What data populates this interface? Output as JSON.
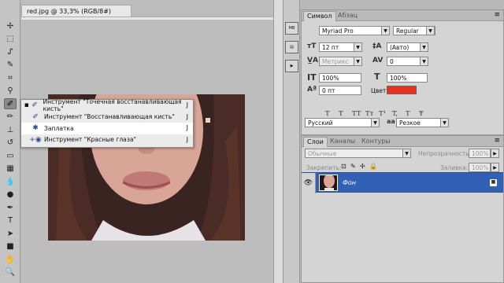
{
  "document": {
    "tab_title": "red.jpg @ 33,3% (RGB/8#)"
  },
  "toolbar": {
    "tools": [
      {
        "name": "move-tool",
        "glyph": "✢"
      },
      {
        "name": "marquee-tool",
        "glyph": "⬚"
      },
      {
        "name": "lasso-tool",
        "glyph": "ᔑ"
      },
      {
        "name": "quick-selection-tool",
        "glyph": "✎"
      },
      {
        "name": "crop-tool",
        "glyph": "⌗"
      },
      {
        "name": "eyedropper-tool",
        "glyph": "⚲"
      },
      {
        "name": "healing-brush-tool",
        "glyph": "✐"
      },
      {
        "name": "brush-tool",
        "glyph": "✏"
      },
      {
        "name": "clone-stamp-tool",
        "glyph": "⊥"
      },
      {
        "name": "history-brush-tool",
        "glyph": "↺"
      },
      {
        "name": "eraser-tool",
        "glyph": "▭"
      },
      {
        "name": "gradient-tool",
        "glyph": "▦"
      },
      {
        "name": "blur-tool",
        "glyph": "💧"
      },
      {
        "name": "dodge-tool",
        "glyph": "●"
      },
      {
        "name": "pen-tool",
        "glyph": "✒"
      },
      {
        "name": "type-tool",
        "glyph": "T"
      },
      {
        "name": "path-selection-tool",
        "glyph": "➤"
      },
      {
        "name": "shape-tool",
        "glyph": "■"
      },
      {
        "name": "hand-tool",
        "glyph": "✋"
      },
      {
        "name": "zoom-tool",
        "glyph": "🔍"
      }
    ]
  },
  "flyout": {
    "items": [
      {
        "mark": "▪",
        "icon": "spot-healing-icon",
        "glyph": "✐",
        "label": "Инструмент \"Точечная восстанавливающая кисть\"",
        "key": "J",
        "selected": false
      },
      {
        "mark": "",
        "icon": "healing-brush-icon",
        "glyph": "✐",
        "label": "Инструмент \"Восстанавливающая кисть\"",
        "key": "J",
        "selected": false
      },
      {
        "mark": "",
        "icon": "patch-icon",
        "glyph": "✱",
        "label": "Заплатка",
        "key": "J",
        "selected": true
      },
      {
        "mark": "",
        "icon": "red-eye-icon",
        "glyph": "+◉",
        "label": "Инструмент \"Красные глаза\"",
        "key": "J",
        "selected": false
      }
    ]
  },
  "character_panel": {
    "tab_active": "Символ",
    "tab_inactive": "Абзац",
    "font_family": "Myriad Pro",
    "font_style": "Regular",
    "font_size": "12 пт",
    "leading": "(Авто)",
    "kerning": "Метрикс",
    "tracking": "0",
    "vertical_scale": "100%",
    "horizontal_scale": "100%",
    "baseline_shift": "0 пт",
    "color_label": "Цвет:",
    "color_value": "#e8321e",
    "format_buttons": [
      "T",
      "T",
      "TT",
      "Tт",
      "T¹",
      "T,",
      "T",
      "Ŧ"
    ],
    "language": "Русский",
    "antialias_icon": "aa",
    "antialias": "Резкое"
  },
  "layers_panel": {
    "tabs": [
      "Слои",
      "Каналы",
      "Контуры"
    ],
    "blend_mode": "Обычные",
    "opacity_label": "Непрозрачность:",
    "opacity_value": "100%",
    "lock_label": "Закрепить:",
    "fill_label": "Заливка:",
    "fill_value": "100%",
    "layer_name": "Фон"
  }
}
